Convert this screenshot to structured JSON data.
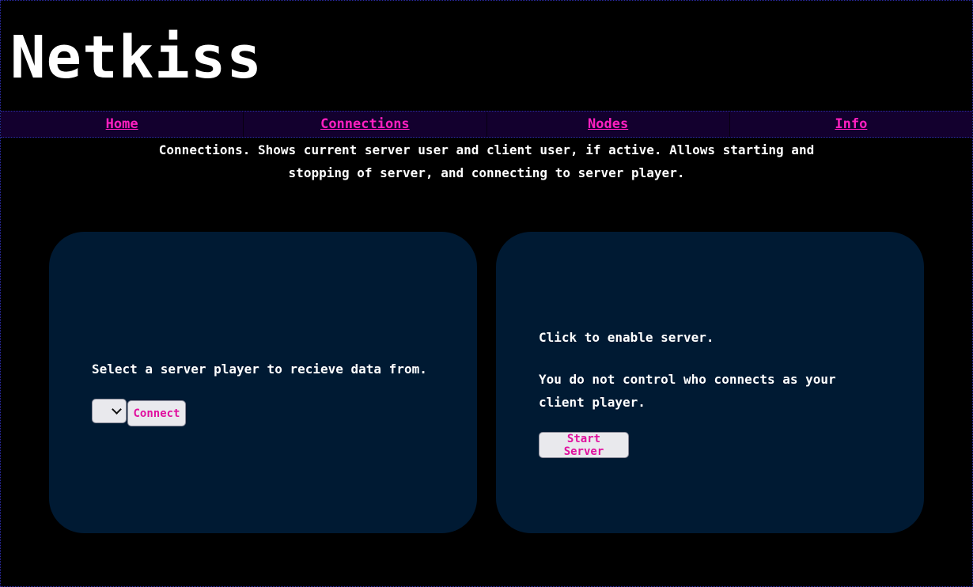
{
  "header": {
    "title": "Netkiss"
  },
  "nav": {
    "items": [
      {
        "label": "Home"
      },
      {
        "label": "Connections"
      },
      {
        "label": "Nodes"
      },
      {
        "label": "Info"
      }
    ]
  },
  "page": {
    "description_line1": "Connections. Shows current server user and client user, if active. Allows starting and",
    "description_line2": "stopping of server, and connecting to server player."
  },
  "client_panel": {
    "prompt": "Select a server player to recieve data from.",
    "server_select_value": "",
    "connect_label": "Connect"
  },
  "server_panel": {
    "status": "Click to enable server.",
    "note_line1": "You do not control who connects as your",
    "note_line2": "client player.",
    "start_label": "Start Server"
  },
  "colors": {
    "background": "#000000",
    "nav_background": "#13002e",
    "link": "#ff1fc0",
    "panel": "#001a33",
    "button_text": "#e0109e"
  }
}
